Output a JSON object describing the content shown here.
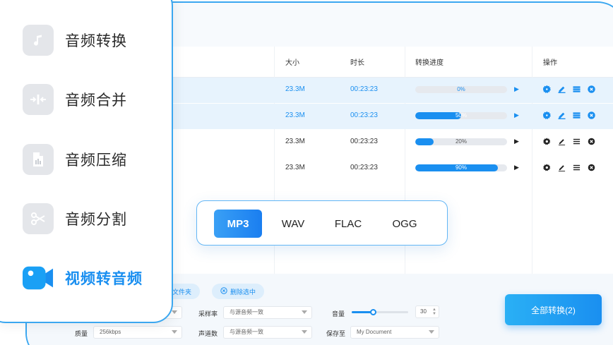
{
  "menu": {
    "items": [
      {
        "label": "音频转换",
        "icon": "music-note-icon"
      },
      {
        "label": "音频合并",
        "icon": "merge-icon"
      },
      {
        "label": "音频压缩",
        "icon": "compress-icon"
      },
      {
        "label": "音频分割",
        "icon": "scissors-icon"
      },
      {
        "label": "视频转音频",
        "icon": "video-camera-icon",
        "active": true
      }
    ]
  },
  "table": {
    "headers": {
      "size": "大小",
      "duration": "时长",
      "progress": "转换进度",
      "ops": "操作"
    },
    "rows": [
      {
        "size": "23.3M",
        "duration": "00:23:23",
        "progress": 0,
        "progress_label": "0%",
        "selected": true
      },
      {
        "size": "23.3M",
        "duration": "00:23:23",
        "progress": 50,
        "progress_label": "50%",
        "selected": true
      },
      {
        "size": "23.3M",
        "duration": "00:23:23",
        "progress": 20,
        "progress_label": "20%",
        "selected": false
      },
      {
        "size": "23.3M",
        "duration": "00:23:23",
        "progress": 90,
        "progress_label": "90%",
        "selected": false
      }
    ]
  },
  "formats": {
    "options": [
      "MP3",
      "WAV",
      "FLAC",
      "OGG"
    ],
    "selected": "MP3"
  },
  "bottom": {
    "add_folder": "文件夹",
    "delete_selected": "删除选中",
    "sample_rate_label": "采样率",
    "sample_rate_value": "与源音频一致",
    "channels_label": "声道数",
    "channels_value": "与源音频一致",
    "quality_label": "质量",
    "quality_value": "256kbps",
    "volume_label": "音量",
    "volume_value": "30",
    "volume_level": 0.38,
    "save_label": "保存至",
    "save_value": "My Document"
  },
  "convert_all": "全部转换(2)",
  "colors": {
    "accent": "#1a8ff0",
    "border": "#3ba7f0"
  }
}
